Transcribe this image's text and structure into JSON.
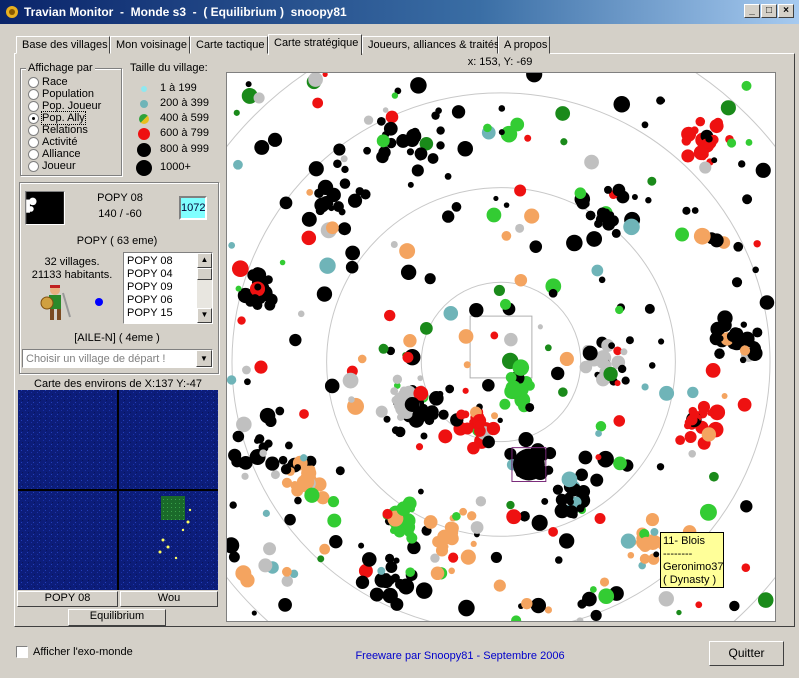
{
  "window": {
    "title": "Travian Monitor  -  Monde s3  -  ( Equilibrium )  snoopy81",
    "minimize_glyph": "_",
    "maximize_glyph": "□",
    "close_glyph": "×"
  },
  "tabs": [
    {
      "label": "Base des villages",
      "active": false
    },
    {
      "label": "Mon voisinage",
      "active": false
    },
    {
      "label": "Carte tactique",
      "active": false
    },
    {
      "label": "Carte stratégique",
      "active": true
    },
    {
      "label": "Joueurs, alliances & traités",
      "active": false
    },
    {
      "label": "A propos",
      "active": false
    }
  ],
  "display_by": {
    "title": "Affichage par",
    "options": [
      "Race",
      "Population",
      "Pop. Joueur",
      "Pop. Ally",
      "Relations",
      "Activité",
      "Alliance",
      "Joueur"
    ],
    "selected": "Pop. Ally"
  },
  "size_legend": {
    "title": "Taille du village:",
    "items": [
      {
        "label": "1 à 199",
        "color": "#8fe8f0"
      },
      {
        "label": "200 à 399",
        "color": "#6fb4b8"
      },
      {
        "label": "400 à 599",
        "color": "#2ea23a"
      },
      {
        "label": "600 à 799",
        "color": "#ee1111"
      },
      {
        "label": "800 à 999",
        "color": "#000000"
      },
      {
        "label": "1000+",
        "color": "#000000"
      }
    ]
  },
  "village": {
    "name": "POPY 08",
    "coords": "140 / -60",
    "pop_badge": "1072",
    "player": "POPY  ( 63 eme)",
    "villages_count": "32 villages.",
    "inhabitants": "21133 habitants.",
    "alliance": "[AILE-N]  ( 4eme )",
    "list": [
      "POPY 08",
      "POPY 04",
      "POPY 09",
      "POPY 06",
      "POPY 15"
    ],
    "start_placeholder": "Choisir un village de départ !"
  },
  "surroundings": {
    "title": "Carte des environs de X:137 Y:-47",
    "left_button": "POPY 08",
    "right_button": "Wou",
    "bottom_button": "Equilibrium"
  },
  "map": {
    "coords_readout": "x: 153,  Y: -69",
    "tooltip": [
      "11- Blois",
      "--------",
      "Geronimo37",
      "( Dynasty )"
    ]
  },
  "footer": {
    "checkbox_label": "Afficher l'exo-monde",
    "credit": "Freeware par Snoopy81 - Septembre 2006",
    "quit": "Quitter"
  },
  "colors": {
    "title_bar": "#0a246a",
    "credit_text": "#0000cc",
    "minimap_bg": "#0c1d7a",
    "pop_badge_bg": "#80ffff",
    "ally_orange": "#f4a460",
    "ally_gray": "#c0c0c0",
    "ally_lightgreen": "#33cc33"
  }
}
